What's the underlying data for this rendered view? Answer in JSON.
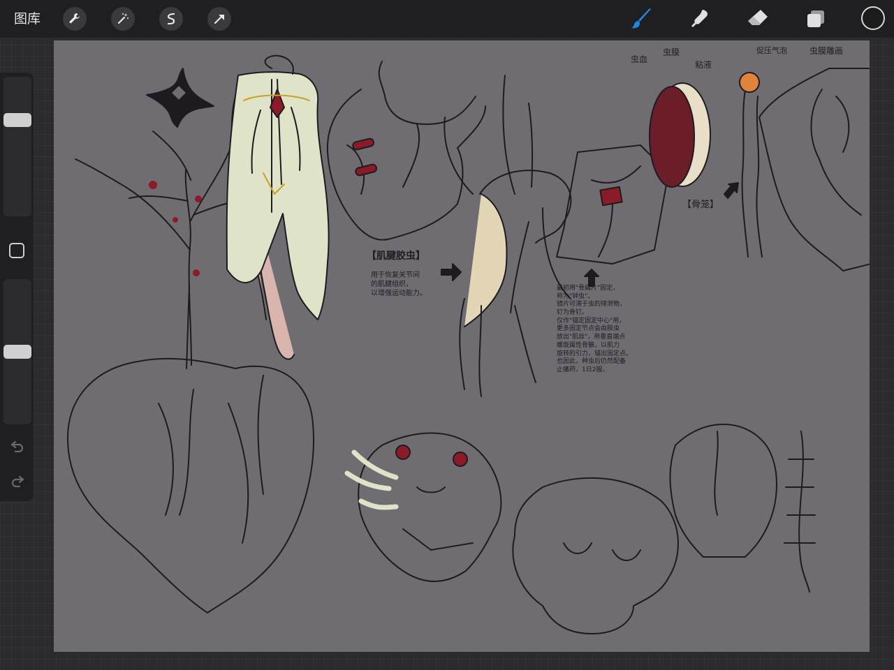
{
  "toolbar": {
    "gallery_label": "图库",
    "left_tools": [
      "wrench-icon",
      "magic-wand-icon",
      "selection-icon",
      "transform-arrow-icon"
    ],
    "right_tools": [
      "brush-icon",
      "smudge-icon",
      "eraser-icon",
      "layers-icon"
    ],
    "active_tool": "brush",
    "accent_color": "#1e88e5",
    "current_color": "#1c1c1c"
  },
  "sidebar": {
    "brush_size": 0.71,
    "brush_opacity": 0.5
  },
  "canvas": {
    "background_color": "#6f6d72",
    "annotations": {
      "tendon_title": "【肌腱胶虫】",
      "tendon_desc": "用于恢复关节间\n的肌腱组织，\n以增强运动能力。",
      "bone_note": "最初用\"骨扁片\"固定，\n称为\"钟虫\"。\n镜片可滞于虫的排泄物，\n钉为骨钉。\n仅作\"锚定固定中心\"用，\n更多固定节点会由肢虫\n放出\"肌丝\"，用垂直端点\n螺旋属性骨骼，以肌力\n旋转的引力，锚出固定点。\n也因此，种虫后仍然配备\n止痛药，1日2服。",
      "bug_body_label": "虫血",
      "bug_membrane_label": "虫膜",
      "mucus_label": "粘液",
      "bone_cage_label": "【骨笼】",
      "pressure_label": "促压气泡",
      "carving_label": "虫膜雕画"
    }
  }
}
